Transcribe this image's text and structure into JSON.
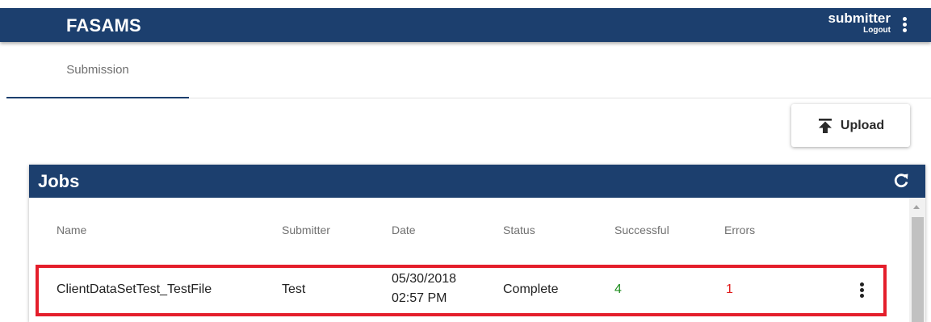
{
  "header": {
    "app_title": "FASAMS",
    "user_name": "submitter",
    "logout_label": "Logout",
    "menu_icon": "more-vertical-icon"
  },
  "tabs": [
    {
      "label": "Submission",
      "active": true
    }
  ],
  "upload": {
    "label": "Upload",
    "icon": "upload-icon"
  },
  "jobs": {
    "title": "Jobs",
    "refresh_icon": "refresh-icon",
    "columns": [
      "Name",
      "Submitter",
      "Date",
      "Status",
      "Successful",
      "Errors"
    ],
    "rows": [
      {
        "name": "ClientDataSetTest_TestFile",
        "submitter": "Test",
        "date_line1": "05/30/2018",
        "date_line2": "02:57 PM",
        "status": "Complete",
        "successful": "4",
        "errors": "1",
        "highlighted": true
      }
    ]
  },
  "colors": {
    "primary": "#1c3f6e",
    "success": "#1e8e1e",
    "error": "#e01b1b",
    "highlight_border": "#e41e2b"
  }
}
